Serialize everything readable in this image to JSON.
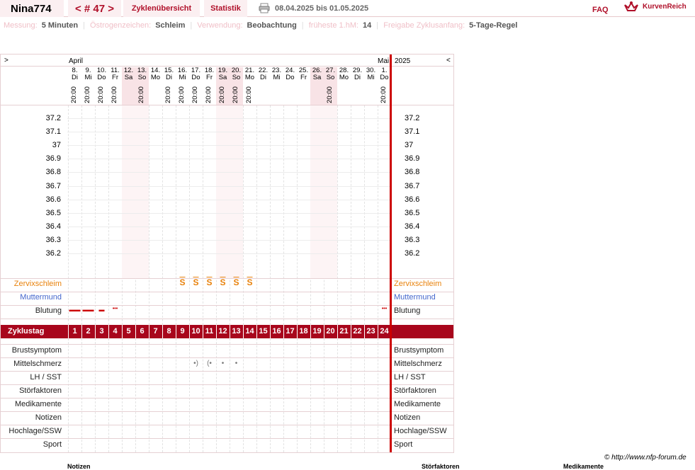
{
  "header": {
    "user": "Nina774",
    "cycle_nav": "< # 47 >",
    "tab_overview": "Zyklenübersicht",
    "tab_stats": "Statistik",
    "date_range": "08.04.2025 bis 01.05.2025",
    "faq": "FAQ",
    "logo": "KurvenReich"
  },
  "settings": [
    {
      "key": "Messung:",
      "value": "5 Minuten"
    },
    {
      "key": "Östrogenzeichen:",
      "value": "Schleim"
    },
    {
      "key": "Verwendung:",
      "value": "Beobachtung"
    },
    {
      "key": "früheste 1.hM:",
      "value": "14"
    },
    {
      "key": "Freigabe Zyklusanfang:",
      "value": "5-Tage-Regel"
    }
  ],
  "chart": {
    "prev": ">",
    "next": "<",
    "month_left": "April",
    "month_right": "Mai",
    "year": "2025",
    "days": [
      {
        "d": "8.",
        "wd": "Di",
        "t": "20:00",
        "we": false
      },
      {
        "d": "9.",
        "wd": "Mi",
        "t": "20:00",
        "we": false
      },
      {
        "d": "10.",
        "wd": "Do",
        "t": "20:00",
        "we": false
      },
      {
        "d": "11.",
        "wd": "Fr",
        "t": "20:00",
        "we": false
      },
      {
        "d": "12.",
        "wd": "Sa",
        "t": "",
        "we": true
      },
      {
        "d": "13.",
        "wd": "So",
        "t": "20:00",
        "we": true
      },
      {
        "d": "14.",
        "wd": "Mo",
        "t": "",
        "we": false
      },
      {
        "d": "15.",
        "wd": "Di",
        "t": "20:00",
        "we": false
      },
      {
        "d": "16.",
        "wd": "Mi",
        "t": "20:00",
        "we": false
      },
      {
        "d": "17.",
        "wd": "Do",
        "t": "20:00",
        "we": false
      },
      {
        "d": "18.",
        "wd": "Fr",
        "t": "20:00",
        "we": false
      },
      {
        "d": "19.",
        "wd": "Sa",
        "t": "20:00",
        "we": true
      },
      {
        "d": "20.",
        "wd": "So",
        "t": "20:00",
        "we": true
      },
      {
        "d": "21.",
        "wd": "Mo",
        "t": "20:00",
        "we": false
      },
      {
        "d": "22.",
        "wd": "Di",
        "t": "",
        "we": false
      },
      {
        "d": "23.",
        "wd": "Mi",
        "t": "",
        "we": false
      },
      {
        "d": "24.",
        "wd": "Do",
        "t": "",
        "we": false
      },
      {
        "d": "25.",
        "wd": "Fr",
        "t": "",
        "we": false
      },
      {
        "d": "26.",
        "wd": "Sa",
        "t": "",
        "we": true
      },
      {
        "d": "27.",
        "wd": "So",
        "t": "20:00",
        "we": true
      },
      {
        "d": "28.",
        "wd": "Mo",
        "t": "",
        "we": false
      },
      {
        "d": "29.",
        "wd": "Di",
        "t": "",
        "we": false
      },
      {
        "d": "30.",
        "wd": "Mi",
        "t": "",
        "we": false
      },
      {
        "d": "1.",
        "wd": "Do",
        "t": "20:00",
        "we": false
      }
    ],
    "temps": [
      "37.2",
      "37.1",
      "37",
      "36.9",
      "36.8",
      "36.7",
      "36.6",
      "36.5",
      "36.4",
      "36.3",
      "36.2"
    ],
    "rows_top": {
      "zervix": "Zervixschleim",
      "muttermund": "Muttermund",
      "blutung": "Blutung"
    },
    "zyklustag": "Zyklustag",
    "cycle_days": [
      "1",
      "2",
      "3",
      "4",
      "5",
      "6",
      "7",
      "8",
      "9",
      "10",
      "11",
      "12",
      "13",
      "14",
      "15",
      "16",
      "17",
      "18",
      "19",
      "20",
      "21",
      "22",
      "23",
      "24"
    ],
    "rows_bottom": [
      "Brustsymptom",
      "Mittelschmerz",
      "LH / SST",
      "Störfaktoren",
      "Medikamente",
      "Notizen",
      "Hochlage/SSW",
      "Sport"
    ],
    "zervix_days": [
      9,
      10,
      11,
      12,
      13,
      14
    ],
    "zervix_symbol": "S",
    "blutung": [
      {
        "day": 1,
        "sym": "▬▬"
      },
      {
        "day": 2,
        "sym": "▬▬"
      },
      {
        "day": 3,
        "sym": "▬"
      },
      {
        "day": 4,
        "sym": "•••"
      },
      {
        "day": 24,
        "sym": "•••"
      }
    ],
    "mittelschmerz": [
      {
        "day": 10,
        "sym": "•)"
      },
      {
        "day": 11,
        "sym": "(•"
      },
      {
        "day": 12,
        "sym": "•"
      },
      {
        "day": 13,
        "sym": "•"
      }
    ]
  },
  "footer": {
    "copyright": "© http://www.nfp-forum.de",
    "bottom_left": "Notizen",
    "bottom_mid": "Störfaktoren",
    "bottom_right": "Medikamente"
  },
  "colors": {
    "accent": "#b0102a",
    "zyklus_bar": "#a8061c",
    "red_line": "#cc0000",
    "zervix": "#e8820c",
    "muttermund": "#4466cc"
  }
}
